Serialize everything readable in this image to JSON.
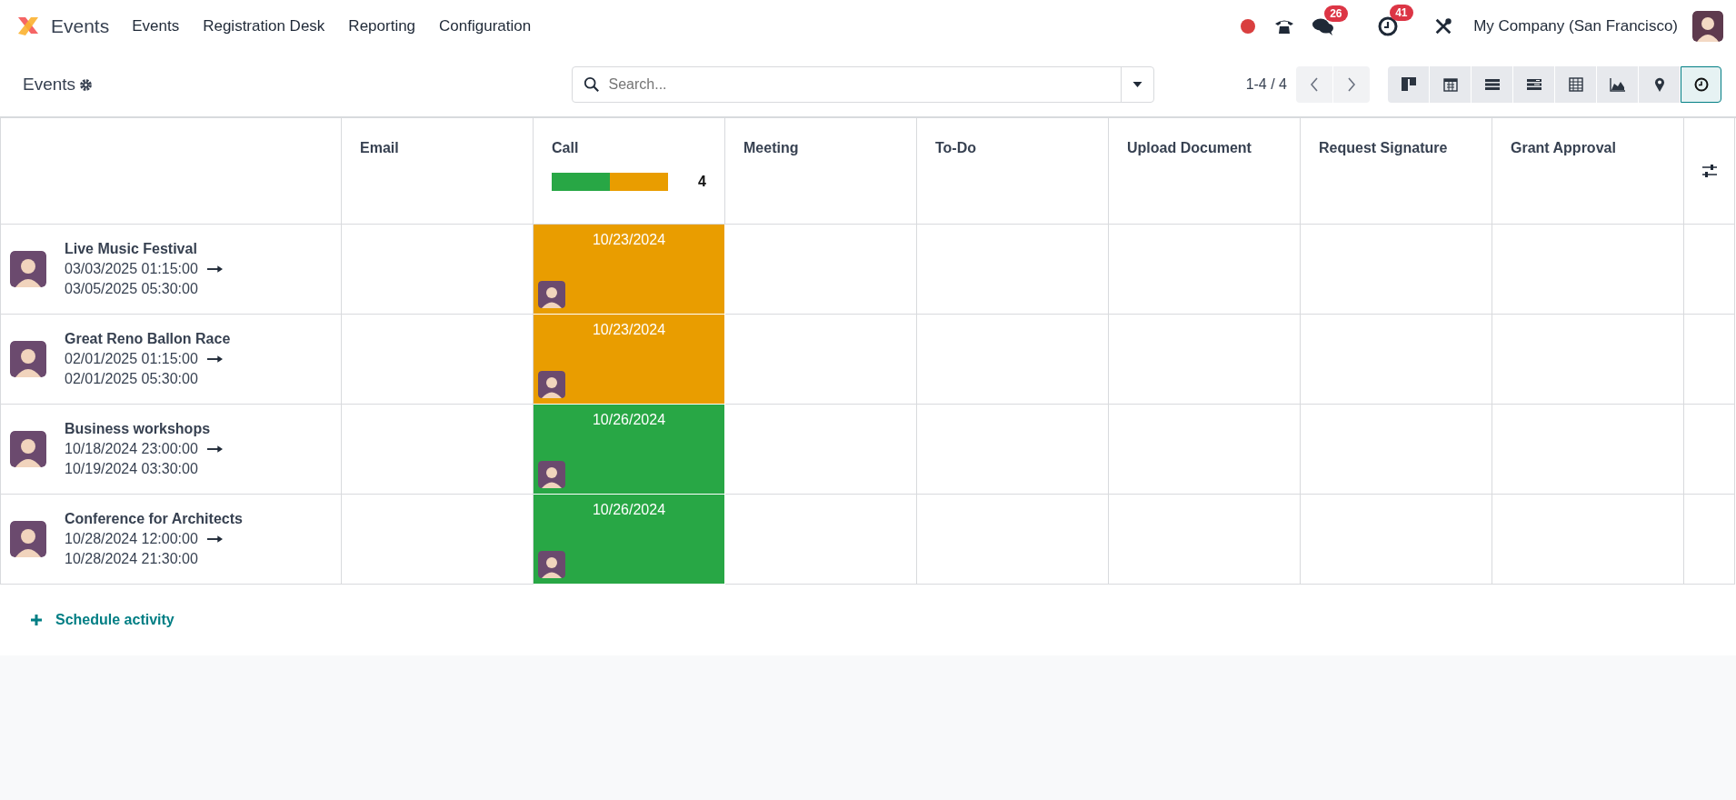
{
  "navbar": {
    "app_name": "Events",
    "menu": [
      "Events",
      "Registration Desk",
      "Reporting",
      "Configuration"
    ],
    "chat_count": "26",
    "activity_count": "41",
    "company": "My Company (San Francisco)"
  },
  "control_panel": {
    "title": "Events",
    "search": {
      "placeholder": "Search..."
    },
    "pager": "1-4 / 4",
    "views": [
      {
        "kind": "kanban",
        "selected": false
      },
      {
        "kind": "calendar",
        "selected": false
      },
      {
        "kind": "list",
        "selected": false
      },
      {
        "kind": "gantt",
        "selected": false
      },
      {
        "kind": "pivot",
        "selected": false
      },
      {
        "kind": "graph",
        "selected": false
      },
      {
        "kind": "map",
        "selected": false
      },
      {
        "kind": "activity",
        "selected": true
      }
    ]
  },
  "table": {
    "columns": [
      {
        "label": "Email"
      },
      {
        "label": "Call",
        "count": "4",
        "progress": [
          {
            "color": "#28a745",
            "level": 0.5
          },
          {
            "color": "#e99d00",
            "level": 0.5
          }
        ]
      },
      {
        "label": "Meeting"
      },
      {
        "label": "To-Do"
      },
      {
        "label": "Upload Document"
      },
      {
        "label": "Request Signature"
      },
      {
        "label": "Grant Approval"
      }
    ],
    "rows": [
      {
        "name": "Live Music Festival",
        "start": "03/03/2025 01:15:00",
        "end": "03/05/2025 05:30:00",
        "cells": [
          null,
          {
            "date": "10/23/2024",
            "color": "#e99d00"
          },
          null,
          null,
          null,
          null,
          null
        ]
      },
      {
        "name": "Great Reno Ballon Race",
        "start": "02/01/2025 01:15:00",
        "end": "02/01/2025 05:30:00",
        "cells": [
          null,
          {
            "date": "10/23/2024",
            "color": "#e99d00"
          },
          null,
          null,
          null,
          null,
          null
        ]
      },
      {
        "name": "Business workshops",
        "start": "10/18/2024 23:00:00",
        "end": "10/19/2024 03:30:00",
        "cells": [
          null,
          {
            "date": "10/26/2024",
            "color": "#28a745"
          },
          null,
          null,
          null,
          null,
          null
        ]
      },
      {
        "name": "Conference for Architects",
        "start": "10/28/2024 12:00:00",
        "end": "10/28/2024 21:30:00",
        "cells": [
          null,
          {
            "date": "10/26/2024",
            "color": "#28a745"
          },
          null,
          null,
          null,
          null,
          null
        ]
      }
    ]
  },
  "schedule_link": "Schedule activity"
}
